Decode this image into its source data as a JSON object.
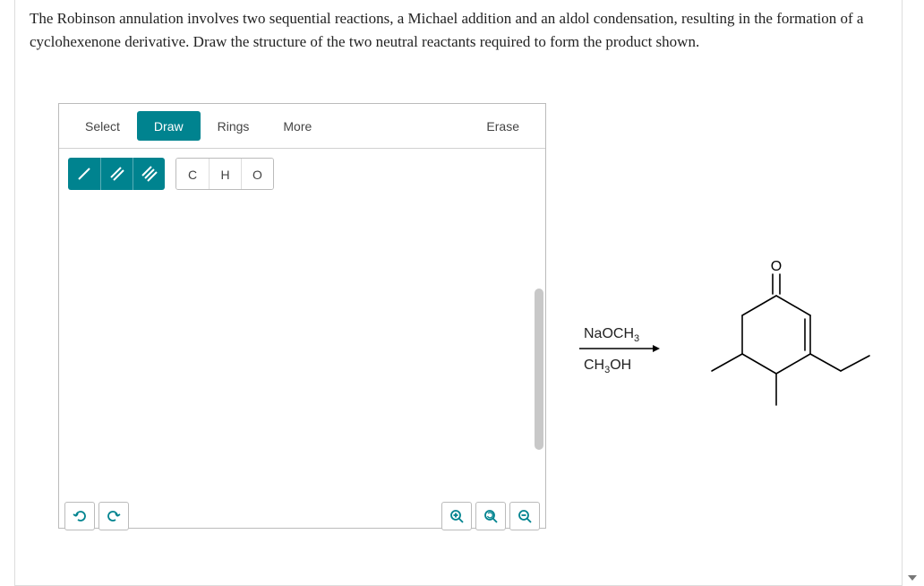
{
  "question": {
    "text": "The Robinson annulation involves two sequential reactions, a Michael addition and an aldol condensation, resulting in the formation of a cyclohexenone derivative. Draw the structure of the two neutral reactants required to form the product shown."
  },
  "tabs": {
    "select": "Select",
    "draw": "Draw",
    "rings": "Rings",
    "more": "More",
    "erase": "Erase"
  },
  "atoms": {
    "c": "C",
    "h": "H",
    "o": "O"
  },
  "reaction": {
    "reagent1_html": "NaOCH<sub>3</sub>",
    "reagent2_html": "CH<sub>3</sub>OH",
    "product_oxygen_label": "O"
  },
  "icons": {
    "undo": "↺",
    "redo": "↻",
    "zoom_in": "⊕",
    "zoom_reset": "⟲",
    "zoom_out": "⊖"
  }
}
